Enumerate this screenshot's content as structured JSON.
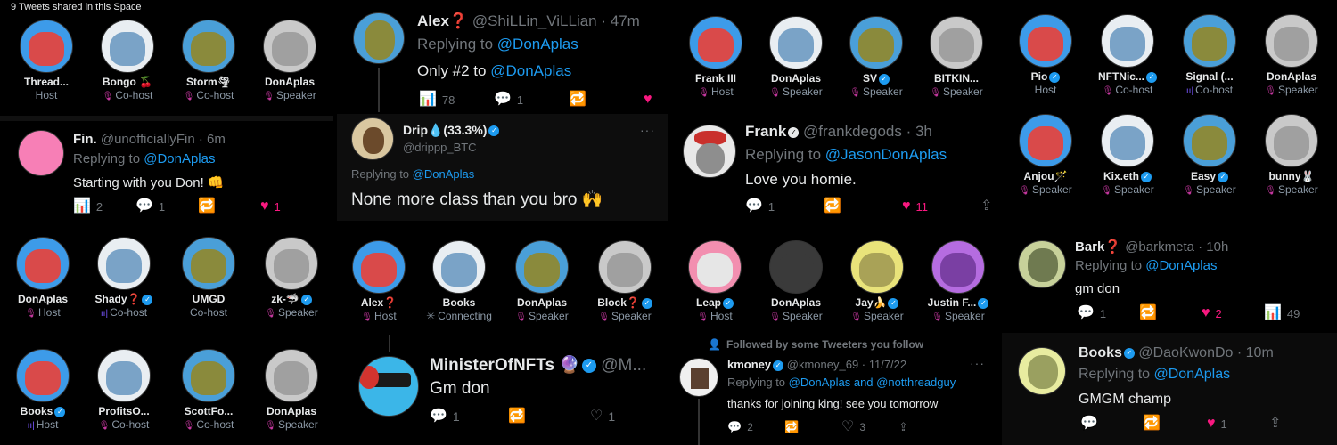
{
  "colors": {
    "accent": "#1d9bf0",
    "like": "#f91880",
    "mic": "#c5379f",
    "muted": "#71767b"
  },
  "p1": {
    "caption": "9 Tweets shared in this Space",
    "speakers": [
      {
        "name": "Thread...",
        "role": "Host",
        "roleicon": "none"
      },
      {
        "name": "Bongo 🍒",
        "role": "Co-host",
        "roleicon": "mic"
      },
      {
        "name": "Storm🌪",
        "role": "Co-host",
        "roleicon": "mic"
      },
      {
        "name": "DonAplas",
        "role": "Speaker",
        "roleicon": "mic"
      }
    ],
    "tweet": {
      "name": "Fin.",
      "handle": "@unofficiallyFin · 6m",
      "replying": "Replying to",
      "mention": "@DonAplas",
      "text": "Starting with you Don! 👊",
      "views": "2",
      "replies": "1",
      "likes": "1"
    }
  },
  "p2": {
    "tweet": {
      "name": "Alex❓",
      "handle": "@ShiLLin_ViLLian · 47m",
      "replying": "Replying to",
      "mention": "@DonAplas",
      "text": "Only #2 to",
      "text_mention": "@DonAplas",
      "views": "78",
      "replies": "1"
    }
  },
  "p3": {
    "tweet": {
      "name": "Drip💧(33.3%)",
      "handle": "@drippp_BTC",
      "more": "···",
      "replying": "Replying to",
      "mention": "@DonAplas",
      "text": "None more class than you bro 🙌"
    }
  },
  "p4": {
    "speakers": [
      {
        "name": "Frank III",
        "role": "Host",
        "roleicon": "mic"
      },
      {
        "name": "DonAplas",
        "role": "Speaker",
        "roleicon": "mic"
      },
      {
        "name": "SV",
        "role": "Speaker",
        "roleicon": "mic",
        "verified": true
      },
      {
        "name": "BITKIN...",
        "role": "Speaker",
        "roleicon": "mic"
      }
    ]
  },
  "p5": {
    "tweet": {
      "name": "Frank",
      "handle": "@frankdegods · 3h",
      "replying": "Replying to",
      "mention": "@JasonDonAplas",
      "text": "Love you homie.",
      "replies": "1",
      "likes": "11"
    }
  },
  "p6": {
    "speakers": [
      {
        "name": "Pio",
        "role": "Host",
        "roleicon": "none",
        "verified": true
      },
      {
        "name": "NFTNic...",
        "role": "Co-host",
        "roleicon": "mic",
        "verified": true
      },
      {
        "name": "Signal (...",
        "role": "Co-host",
        "roleicon": "dots"
      },
      {
        "name": "DonAplas",
        "role": "Speaker",
        "roleicon": "mic"
      },
      {
        "name": "Anjou🪄",
        "role": "Speaker",
        "roleicon": "mic"
      },
      {
        "name": "Kix.eth",
        "role": "Speaker",
        "roleicon": "mic",
        "verified": true
      },
      {
        "name": "Easy",
        "role": "Speaker",
        "roleicon": "mic",
        "verified": true
      },
      {
        "name": "bunny🐰",
        "role": "Speaker",
        "roleicon": "mic"
      }
    ]
  },
  "p7": {
    "speakers": [
      {
        "name": "DonAplas",
        "role": "Host",
        "roleicon": "mic"
      },
      {
        "name": "Shady❓",
        "role": "Co-host",
        "roleicon": "dots",
        "verified": true
      },
      {
        "name": "UMGD",
        "role": "Co-host",
        "roleicon": "none"
      },
      {
        "name": "zk-🦈",
        "role": "Speaker",
        "roleicon": "mic",
        "verified": true
      },
      {
        "name": "Books",
        "role": "Host",
        "roleicon": "dots",
        "verified": true
      },
      {
        "name": "ProfitsO...",
        "role": "Co-host",
        "roleicon": "mic"
      },
      {
        "name": "ScottFo...",
        "role": "Co-host",
        "roleicon": "mic"
      },
      {
        "name": "DonAplas",
        "role": "Speaker",
        "roleicon": "mic"
      }
    ]
  },
  "p8": {
    "speakers": [
      {
        "name": "Alex❓",
        "role": "Host",
        "roleicon": "mic"
      },
      {
        "name": "Books",
        "role": "Connecting",
        "roleicon": "spin"
      },
      {
        "name": "DonAplas",
        "role": "Speaker",
        "roleicon": "mic"
      },
      {
        "name": "Block❓",
        "role": "Speaker",
        "roleicon": "mic",
        "verified": true
      }
    ]
  },
  "p9": {
    "tweet": {
      "name": "MinisterOfNFTs 🔮",
      "handle": "@M...",
      "text": "Gm don",
      "replies": "1",
      "likes": "1"
    }
  },
  "p10": {
    "speakers": [
      {
        "name": "Leap",
        "role": "Host",
        "roleicon": "mic",
        "verified": true
      },
      {
        "name": "DonAplas",
        "role": "Speaker",
        "roleicon": "mic"
      },
      {
        "name": "Jay🍌",
        "role": "Speaker",
        "roleicon": "mic",
        "verified": true
      },
      {
        "name": "Justin F...",
        "role": "Speaker",
        "roleicon": "mic",
        "verified": true
      }
    ]
  },
  "p11": {
    "followed": "Followed by some Tweeters you follow",
    "tweet": {
      "name": "kmoney",
      "handle": "@kmoney_69 · 11/7/22",
      "more": "···",
      "replying": "Replying to",
      "mention": "@DonAplas and @notthreadguy",
      "text": "thanks for joining king! see you tomorrow",
      "replies": "2",
      "likes": "3"
    }
  },
  "p12": {
    "tweet": {
      "name": "Bark❓",
      "handle": "@barkmeta · 10h",
      "replying": "Replying to",
      "mention": "@DonAplas",
      "text": "gm don",
      "replies": "1",
      "likes": "2",
      "views": "49"
    }
  },
  "p13": {
    "tweet": {
      "name": "Books",
      "handle": "@DaoKwonDo · 10m",
      "replying": "Replying to",
      "mention": "@DonAplas",
      "text": "GMGM champ",
      "likes": "1"
    }
  }
}
